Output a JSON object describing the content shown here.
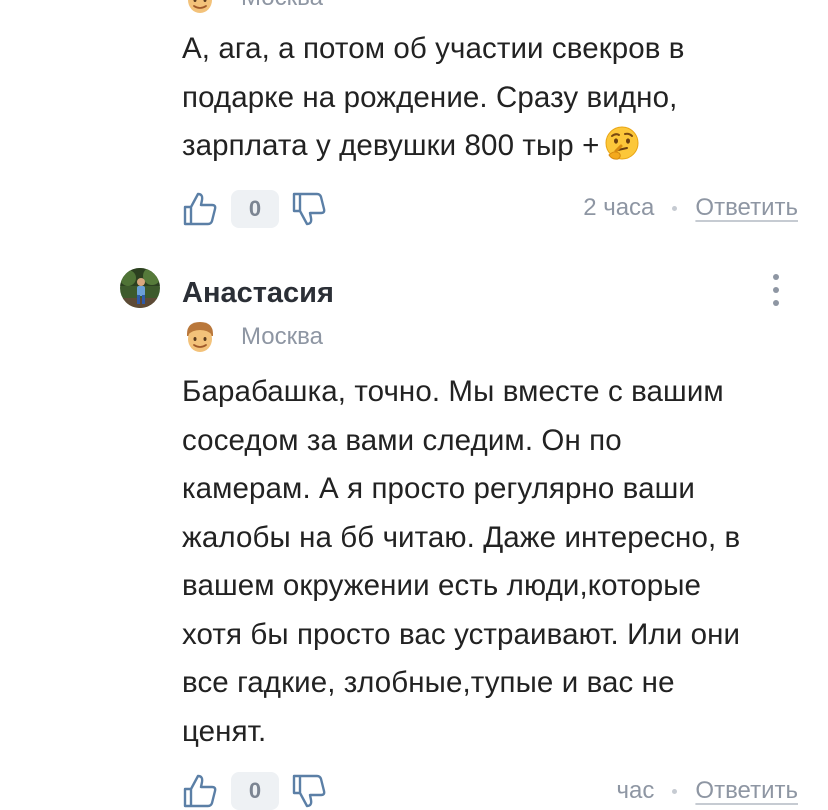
{
  "comment_prev": {
    "city": "Москва",
    "text_lines": [
      "А, ага, а потом об участии свекров в",
      "подарке на рождение. Сразу видно,",
      "зарплата у девушки 800 тыр +"
    ],
    "emoji_icon": "thinking-face-emoji",
    "score": "0",
    "time": "2 часа",
    "reply_label": "Ответить"
  },
  "comment_main": {
    "author": "Анастасия",
    "city": "Москва",
    "text_lines": [
      "Барабашка, точно. Мы вместе с вашим",
      "соседом за вами следим. Он по",
      "камерам. А я просто регулярно ваши",
      "жалобы на бб читаю. Даже интересно, в",
      "вашем окружении есть люди,которые",
      "хотя бы просто вас устраивают. Или они",
      "все гадкие, злобные,тупые и вас не",
      "ценят."
    ],
    "score": "0",
    "time": "час",
    "reply_label": "Ответить"
  },
  "icons": {
    "like": "thumbs-up-icon",
    "dislike": "thumbs-down-icon",
    "more": "more-vertical-icon",
    "city_emoji": "man-face-emoji"
  },
  "colors": {
    "text": "#222222",
    "muted": "#8e96a3",
    "score_bg": "#eef1f4",
    "icon_blue": "#5b7fa6"
  }
}
